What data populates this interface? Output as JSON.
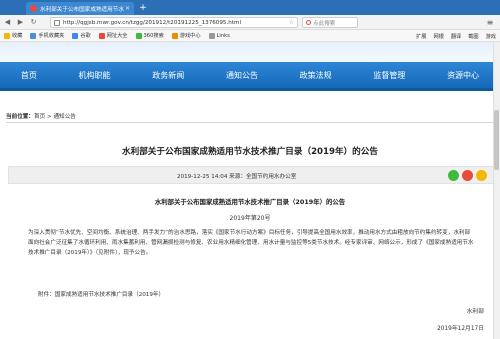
{
  "browser": {
    "tab_title": "水利部关于公布国家成熟适用节水",
    "url": "http://qgjsb.mwr.gov.cn/tzgg/201912/t20191225_1376095.html",
    "search_placeholder": "点此搜索",
    "bookmarks": [
      "收藏",
      "手机收藏夹",
      "谷歌",
      "网址大全",
      "360搜索",
      "游戏中心",
      "Links"
    ],
    "bookmarks_right": [
      "扩展",
      "网银",
      "翻译",
      "截图",
      "游戏"
    ]
  },
  "nav": {
    "items": [
      "首页",
      "机构职能",
      "政务新闻",
      "通知公告",
      "政策法规",
      "监督管理",
      "资源中心"
    ]
  },
  "breadcrumb": {
    "prefix": "当前位置：",
    "home": "首页",
    "sep": " > ",
    "current": "通知公告"
  },
  "article": {
    "title": "水利部关于公布国家成熟适用节水技术推广目录（2019年）的公告",
    "meta": "2019-12-25 14:04   来源：全国节约用水办公室",
    "subtitle": "水利部关于公布国家成熟适用节水技术推广目录（2019年）的公告",
    "doc_no": "2019年第20号",
    "body": "为深入贯彻“节水优先、空间均衡、系统治理、两手发力”的治水思路，落实《国家节水行动方案》目标任务，引导提高全国用水效率，推动用水方式由粗放向节约集约转变，水利部面向社会广泛征集了水循环利用、雨水集蓄利用、管网漏损检测与修复、农业用水精细化管理、用水计量与监控等5类节水技术。经专家评审、网络公示，形成了《国家成熟适用节水技术推广目录（2019年）》（见附件），现予公告。",
    "attachment": "附件：国家成熟适用节水技术推广目录（2019年）",
    "signature": "水利部",
    "date": "2019年12月17日"
  }
}
